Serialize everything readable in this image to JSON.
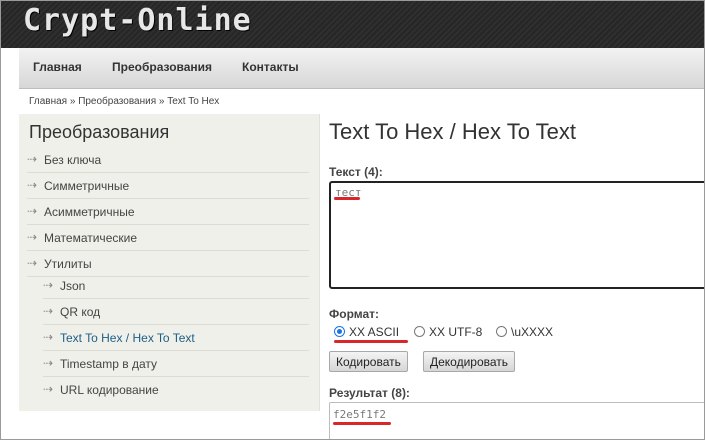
{
  "header": {
    "logo": "Crypt-Online"
  },
  "nav": {
    "items": [
      "Главная",
      "Преобразования",
      "Контакты"
    ]
  },
  "breadcrumb": {
    "home": "Главная",
    "sep": "»",
    "section": "Преобразования",
    "current": "Text To Hex"
  },
  "sidebar": {
    "title": "Преобразования",
    "arrow": "⇢",
    "items": [
      {
        "label": "Без ключа"
      },
      {
        "label": "Симметричные"
      },
      {
        "label": "Асимметричные"
      },
      {
        "label": "Математические"
      },
      {
        "label": "Утилиты"
      }
    ],
    "subitems": [
      {
        "label": "Json"
      },
      {
        "label": "QR код"
      },
      {
        "label": "Text To Hex / Hex To Text",
        "active": true
      },
      {
        "label": "Timestamp в дату"
      },
      {
        "label": "URL кодирование"
      }
    ]
  },
  "main": {
    "title": "Text To Hex / Hex To Text",
    "text_label": "Текст (4):",
    "text_value": "тест",
    "format_label": "Формат:",
    "formats": [
      {
        "label": "XX ASCII",
        "checked": true
      },
      {
        "label": "XX UTF-8",
        "checked": false
      },
      {
        "label": "\\uXXXX",
        "checked": false
      }
    ],
    "encode_button": "Кодировать",
    "decode_button": "Декодировать",
    "result_label": "Результат (8):",
    "result_value": "f2e5f1f2"
  },
  "colors": {
    "highlight": "#d9262b",
    "link_active": "#1d5e86",
    "radio_accent": "#1a73e8"
  }
}
